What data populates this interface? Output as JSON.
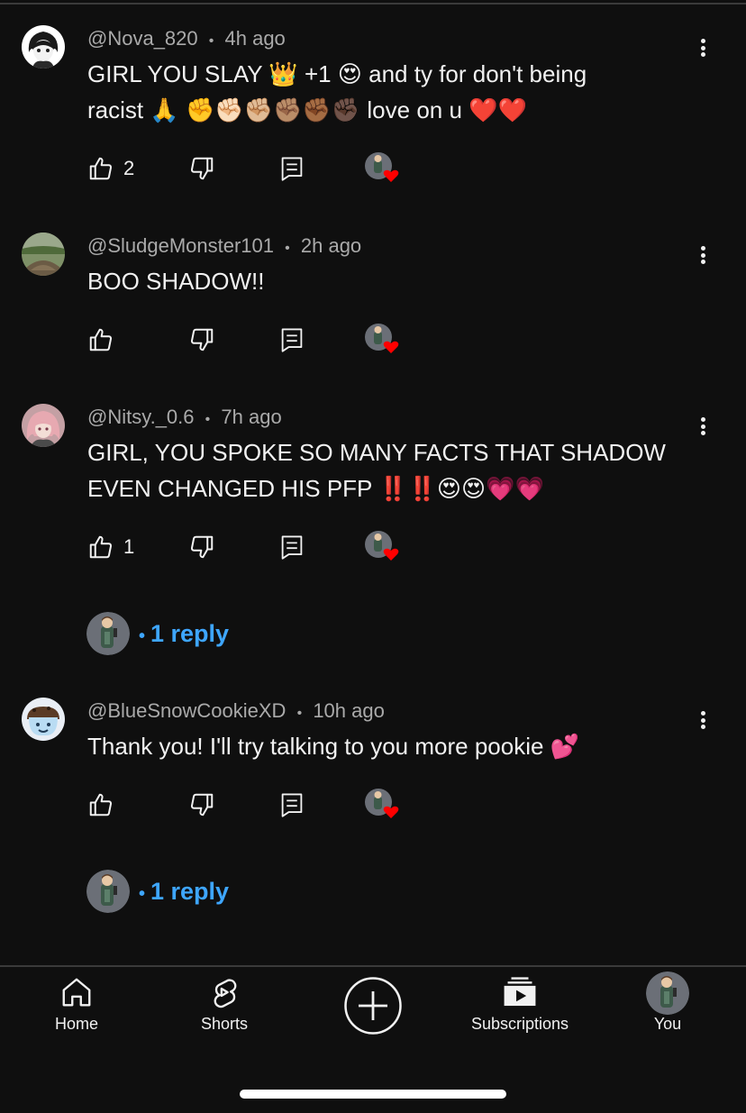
{
  "comments": [
    {
      "author": "@Nova_820",
      "time": "4h ago",
      "line1": "GIRL YOU SLAY 👑 +1 😍 and ty for don't being",
      "line2": "racist 🙏 ✊✊🏻✊🏼✊🏽✊🏾✊🏿 love on u ❤️❤️",
      "likes": "2",
      "avatar_icon": "anime-character-avatar"
    },
    {
      "author": "@SludgeMonster101",
      "time": "2h ago",
      "line1": "BOO SHADOW!!",
      "line2": "",
      "likes": "",
      "avatar_icon": "landscape-avatar"
    },
    {
      "author": "@Nitsy._0.6",
      "time": "7h ago",
      "line1": "GIRL, YOU SPOKE SO MANY FACTS THAT SHADOW",
      "line2": "EVEN CHANGED HIS PFP ‼️‼️😍😍💗💗",
      "likes": "1",
      "avatar_icon": "pink-hair-avatar"
    },
    {
      "author": "@BlueSnowCookieXD",
      "time": "10h ago",
      "line1": "Thank you! I'll try talking to you more pookie 💕",
      "line2": "",
      "likes": "",
      "avatar_icon": "cookie-character-avatar"
    }
  ],
  "replies": [
    {
      "label": "1 reply"
    },
    {
      "label": "1 reply"
    }
  ],
  "separator": "•",
  "nav": {
    "home": "Home",
    "shorts": "Shorts",
    "subscriptions": "Subscriptions",
    "you": "You"
  },
  "colors": {
    "background": "#0f0f0f",
    "meta": "#aaaaaa",
    "link": "#3ea6ff",
    "heart": "#ff0000"
  }
}
